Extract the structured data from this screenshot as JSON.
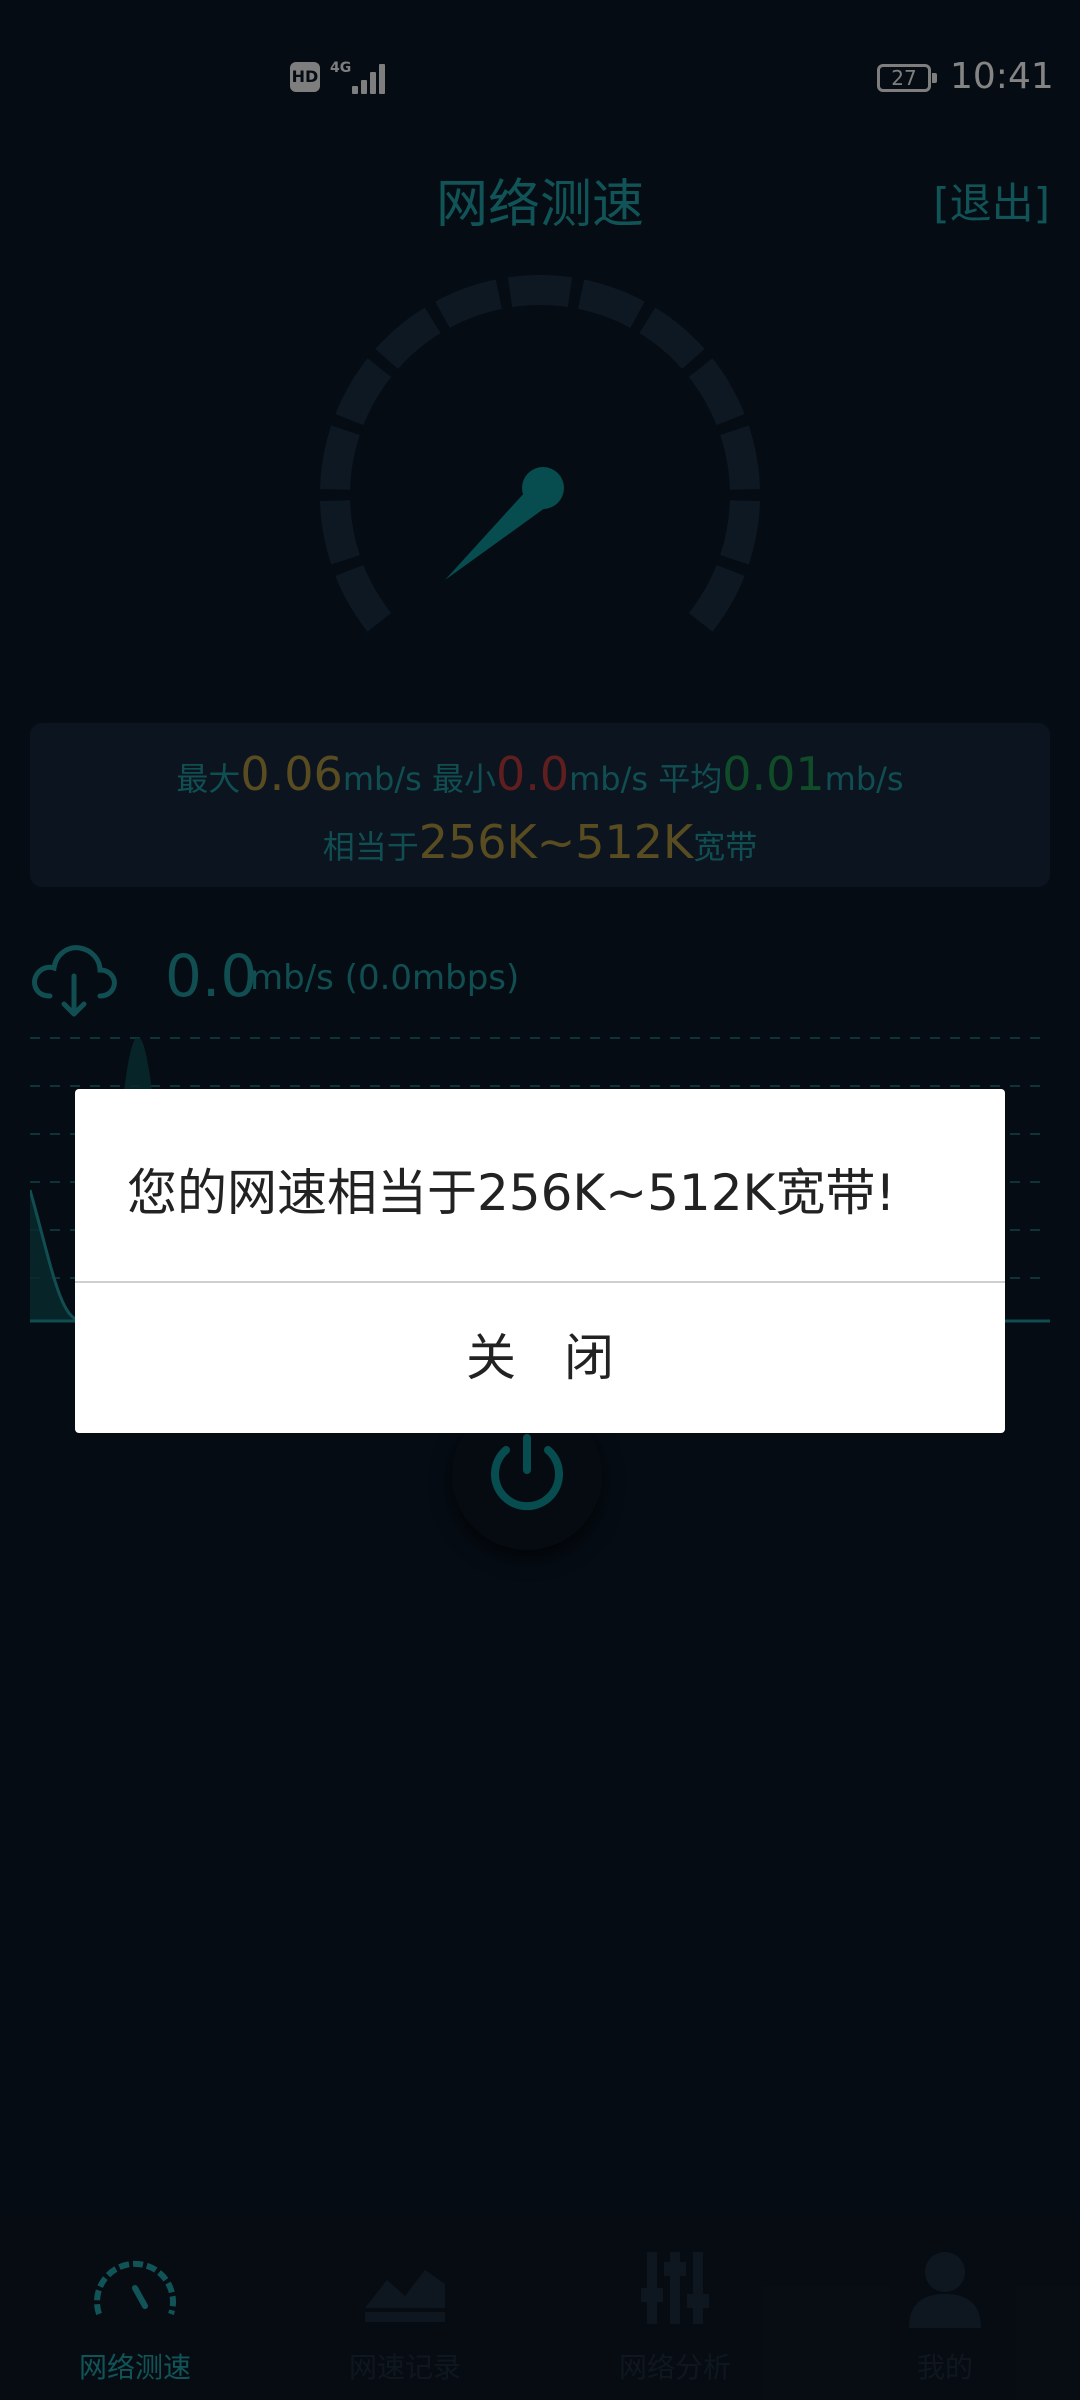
{
  "status_bar": {
    "hd": "HD",
    "network": "4G",
    "battery": "27",
    "time": "10:41"
  },
  "header": {
    "title": "网络测速",
    "logout": "[退出]"
  },
  "stats": {
    "max_label": "最大",
    "max_value": "0.06",
    "max_unit": "mb/s",
    "min_label": "最小",
    "min_value": "0.0",
    "min_unit": "mb/s",
    "avg_label": "平均",
    "avg_value": "0.01",
    "avg_unit": "mb/s",
    "equiv_prefix": "相当于",
    "equiv_value": "256K~512K",
    "equiv_suffix": "宽带"
  },
  "download": {
    "value": "0.0",
    "unit": "mb/s (0.0mbps)"
  },
  "dialog": {
    "message": "您的网速相当于256K~512K宽带!",
    "close": "关闭"
  },
  "nav": {
    "items": [
      {
        "label": "网络测速",
        "icon": "speedometer-icon"
      },
      {
        "label": "网速记录",
        "icon": "chart-icon"
      },
      {
        "label": "网络分析",
        "icon": "sliders-icon"
      },
      {
        "label": "我的",
        "icon": "user-icon"
      }
    ]
  },
  "colors": {
    "accent": "#1f9aa0",
    "max": "#a28a3c",
    "min": "#b03838",
    "avg": "#1f8a4a"
  }
}
